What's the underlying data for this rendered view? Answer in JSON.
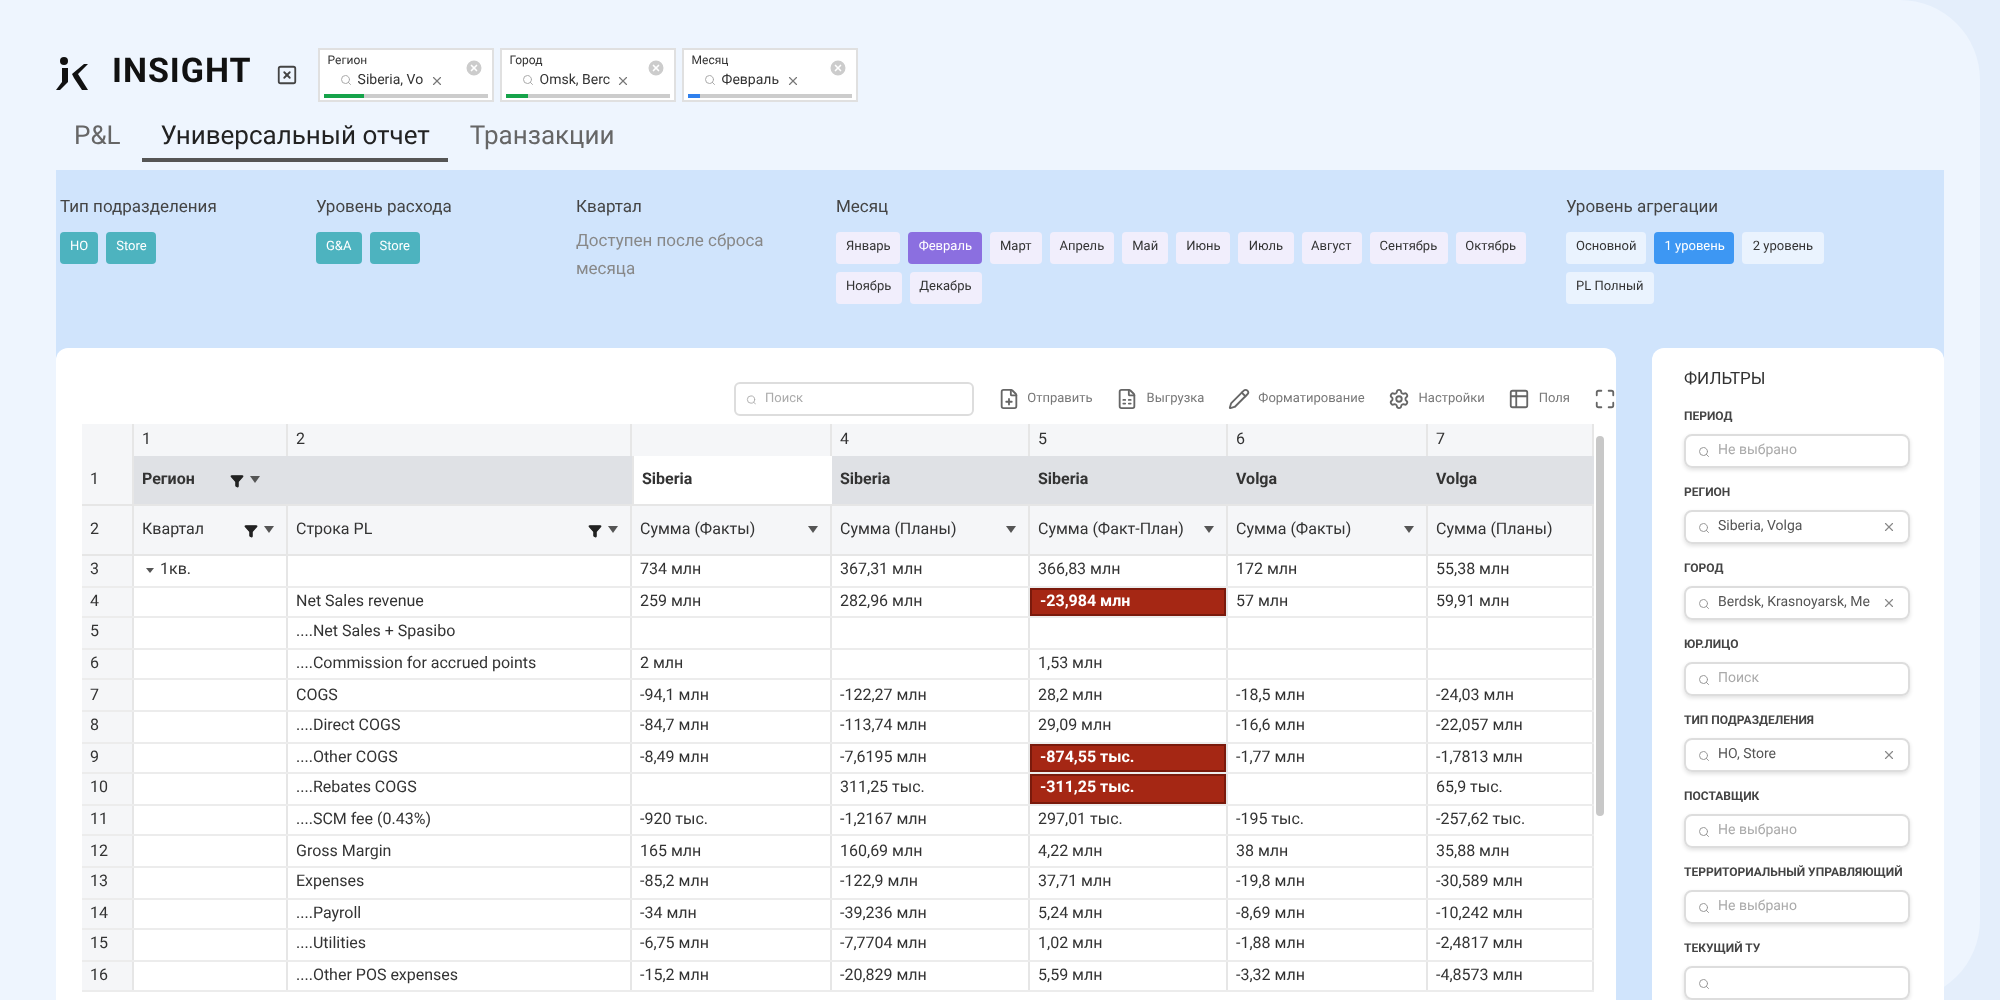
{
  "header": {
    "logo": "INSIGHT",
    "chips": [
      {
        "label": "Регион",
        "value": "Siberia, Vo",
        "level": 0.25,
        "color": "#16a34a"
      },
      {
        "label": "Город",
        "value": "Omsk, Berc",
        "level": 0.14,
        "color": "#16a34a"
      },
      {
        "label": "Месяц",
        "value": "Февраль",
        "level": 0.08,
        "color": "#2f80ed"
      }
    ]
  },
  "tabs": [
    {
      "label": "P&L",
      "selected": false
    },
    {
      "label": "Универсальный отчет",
      "selected": true
    },
    {
      "label": "Транзакции",
      "selected": false
    }
  ],
  "filter_bar": [
    {
      "kind": "buttons",
      "title": "Тип подразделения",
      "options": [
        {
          "label": "HO",
          "selected": true
        },
        {
          "label": "Store",
          "selected": true
        }
      ]
    },
    {
      "kind": "buttons",
      "title": "Уровень расхода",
      "options": [
        {
          "label": "G&A",
          "selected": true
        },
        {
          "label": "Store",
          "selected": true
        }
      ]
    },
    {
      "kind": "note",
      "title": "Квартал",
      "note": "Доступен после сброса месяца"
    },
    {
      "kind": "buttons",
      "title": "Месяц",
      "options": [
        {
          "label": "Январь",
          "selected": false
        },
        {
          "label": "Февраль",
          "selected": true
        },
        {
          "label": "Март",
          "selected": false
        },
        {
          "label": "Апрель",
          "selected": false
        },
        {
          "label": "Май",
          "selected": false
        },
        {
          "label": "Июнь",
          "selected": false
        },
        {
          "label": "Июль",
          "selected": false
        },
        {
          "label": "Август",
          "selected": false
        },
        {
          "label": "Сентябрь",
          "selected": false
        },
        {
          "label": "Октябрь",
          "selected": false
        },
        {
          "label": "Ноябрь",
          "selected": false
        },
        {
          "label": "Декабрь",
          "selected": false
        }
      ]
    },
    {
      "kind": "buttons",
      "title": "Уровень агрегации",
      "options": [
        {
          "label": "Основной",
          "selected": false
        },
        {
          "label": "1 уровень",
          "selected": true
        },
        {
          "label": "2 уровень",
          "selected": false
        },
        {
          "label": "PL Полный",
          "selected": false
        }
      ]
    }
  ],
  "toolbar": {
    "search_placeholder": "Поиск",
    "actions": [
      {
        "kind": "send",
        "label": "Отправить"
      },
      {
        "kind": "export",
        "label": "Выгрузка"
      },
      {
        "kind": "format",
        "label": "Форматирование"
      },
      {
        "kind": "settings",
        "label": "Настройки"
      },
      {
        "kind": "fields",
        "label": "Поля"
      },
      {
        "kind": "fullscreen"
      }
    ]
  },
  "table": {
    "columns": [
      {
        "index": "1",
        "header": "Регион",
        "subheader": "Квартал",
        "filter": true,
        "sort_caret": true
      },
      {
        "index": "2",
        "subheader": "Строка PL",
        "filter": true,
        "sort_caret": true
      },
      {
        "header": "Siberia",
        "subheader": "Сумма (Факты)",
        "filter": false,
        "sort_caret": true
      },
      {
        "index": "4",
        "header": "Siberia",
        "subheader": "Сумма (Планы)",
        "filter": false,
        "sort_caret": true
      },
      {
        "index": "5",
        "header": "Siberia",
        "subheader": "Сумма (Факт-План)",
        "filter": false,
        "sort_caret": true
      },
      {
        "index": "6",
        "header": "Volga",
        "subheader": "Сумма (Факты)",
        "filter": false,
        "sort_caret": true
      },
      {
        "index": "7",
        "header": "Volga",
        "subheader": "Сумма (Планы)",
        "filter": false,
        "sort_caret": false
      }
    ],
    "header_row_numbers": [
      "1",
      "2"
    ],
    "rows": [
      {
        "number": "3",
        "quarter": "1кв.",
        "expanded": true,
        "values": [
          {
            "text": "734 млн",
            "highlighted": false
          },
          {
            "text": "367,31 млн",
            "highlighted": false
          },
          {
            "text": "366,83 млн",
            "highlighted": false
          },
          {
            "text": "172 млн",
            "highlighted": false
          },
          {
            "text": "55,38 млн",
            "highlighted": false
          }
        ]
      },
      {
        "number": "4",
        "line": "Net Sales revenue",
        "values": [
          {
            "text": "259 млн",
            "highlighted": false
          },
          {
            "text": "282,96 млн",
            "highlighted": false
          },
          {
            "text": "-23,984 млн",
            "highlighted": true
          },
          {
            "text": "57 млн",
            "highlighted": false
          },
          {
            "text": "59,91 млн",
            "highlighted": false
          }
        ]
      },
      {
        "number": "5",
        "line": "....Net Sales + Spasibo",
        "values": {}
      },
      {
        "number": "6",
        "line": "....Commission for accrued points",
        "values": {
          "column_3": {
            "text": "2 млн",
            "highlighted": false
          },
          "column_5": {
            "text": "1,53 млн",
            "highlighted": false
          }
        }
      },
      {
        "number": "7",
        "line": "COGS",
        "values": [
          {
            "text": "-94,1 млн",
            "highlighted": false
          },
          {
            "text": "-122,27 млн",
            "highlighted": false
          },
          {
            "text": "28,2 млн",
            "highlighted": false
          },
          {
            "text": "-18,5 млн",
            "highlighted": false
          },
          {
            "text": "-24,03 млн",
            "highlighted": false
          }
        ]
      },
      {
        "number": "8",
        "line": "....Direct COGS",
        "values": [
          {
            "text": "-84,7 млн",
            "highlighted": false
          },
          {
            "text": "-113,74 млн",
            "highlighted": false
          },
          {
            "text": "29,09 млн",
            "highlighted": false
          },
          {
            "text": "-16,6 млн",
            "highlighted": false
          },
          {
            "text": "-22,057 млн",
            "highlighted": false
          }
        ]
      },
      {
        "number": "9",
        "line": "....Other COGS",
        "values": [
          {
            "text": "-8,49 млн",
            "highlighted": false
          },
          {
            "text": "-7,6195 млн",
            "highlighted": false
          },
          {
            "text": "-874,55 тыс.",
            "highlighted": true
          },
          {
            "text": "-1,77 млн",
            "highlighted": false
          },
          {
            "text": "-1,7813 млн",
            "highlighted": false
          }
        ]
      },
      {
        "number": "10",
        "line": "....Rebates COGS",
        "values": {
          "column_4": {
            "text": "311,25 тыс.",
            "highlighted": false
          },
          "column_5": {
            "text": "-311,25 тыс.",
            "highlighted": true
          },
          "column_7": {
            "text": "65,9 тыс.",
            "highlighted": false
          }
        }
      },
      {
        "number": "11",
        "line": "....SCM fee (0.43%)",
        "values": [
          {
            "text": "-920 тыс.",
            "highlighted": false
          },
          {
            "text": "-1,2167 млн",
            "highlighted": false
          },
          {
            "text": "297,01 тыс.",
            "highlighted": false
          },
          {
            "text": "-195 тыс.",
            "highlighted": false
          },
          {
            "text": "-257,62 тыс.",
            "highlighted": false
          }
        ]
      },
      {
        "number": "12",
        "line": "Gross Margin",
        "values": [
          {
            "text": "165 млн",
            "highlighted": false
          },
          {
            "text": "160,69 млн",
            "highlighted": false
          },
          {
            "text": "4,22 млн",
            "highlighted": false
          },
          {
            "text": "38 млн",
            "highlighted": false
          },
          {
            "text": "35,88 млн",
            "highlighted": false
          }
        ]
      },
      {
        "number": "13",
        "line": "Expenses",
        "values": [
          {
            "text": "-85,2 млн",
            "highlighted": false
          },
          {
            "text": "-122,9 млн",
            "highlighted": false
          },
          {
            "text": "37,71 млн",
            "highlighted": false
          },
          {
            "text": "-19,8 млн",
            "highlighted": false
          },
          {
            "text": "-30,589 млн",
            "highlighted": false
          }
        ]
      },
      {
        "number": "14",
        "line": "....Payroll",
        "values": [
          {
            "text": "-34 млн",
            "highlighted": false
          },
          {
            "text": "-39,236 млн",
            "highlighted": false
          },
          {
            "text": "5,24 млн",
            "highlighted": false
          },
          {
            "text": "-8,69 млн",
            "highlighted": false
          },
          {
            "text": "-10,242 млн",
            "highlighted": false
          }
        ]
      },
      {
        "number": "15",
        "line": "....Utilities",
        "values": [
          {
            "text": "-6,75 млн",
            "highlighted": false
          },
          {
            "text": "-7,7704 млн",
            "highlighted": false
          },
          {
            "text": "1,02 млн",
            "highlighted": false
          },
          {
            "text": "-1,88 млн",
            "highlighted": false
          },
          {
            "text": "-2,4817 млн",
            "highlighted": false
          }
        ]
      },
      {
        "number": "16",
        "line": "....Other POS expenses",
        "values": [
          {
            "text": "-15,2 млн",
            "highlighted": false
          },
          {
            "text": "-20,829 млн",
            "highlighted": false
          },
          {
            "text": "5,59 млн",
            "highlighted": false
          },
          {
            "text": "-3,32 млн",
            "highlighted": false
          },
          {
            "text": "-4,8573 млн",
            "highlighted": false
          }
        ]
      }
    ]
  },
  "filters_panel": {
    "title": "ФИЛЬТРЫ",
    "fields": [
      {
        "label": "ПЕРИОД",
        "placeholder": "Не выбрано"
      },
      {
        "label": "РЕГИОН",
        "value": "Siberia, Volga"
      },
      {
        "label": "ГОРОД",
        "value": "Berdsk, Krasnoyarsk, Me"
      },
      {
        "label": "ЮР.ЛИЦО",
        "placeholder": "Поиск"
      },
      {
        "label": "ТИП ПОДРАЗДЕЛЕНИЯ",
        "value": "HO, Store"
      },
      {
        "label": "ПОСТАВЩИК",
        "placeholder": "Не выбрано"
      },
      {
        "label": "ТЕРРИТОРИАЛЬНЫЙ УПРАВЛЯЮЩИЙ",
        "placeholder": "Не выбрано"
      },
      {
        "label": "ТЕКУЩИЙ ТУ"
      }
    ]
  }
}
